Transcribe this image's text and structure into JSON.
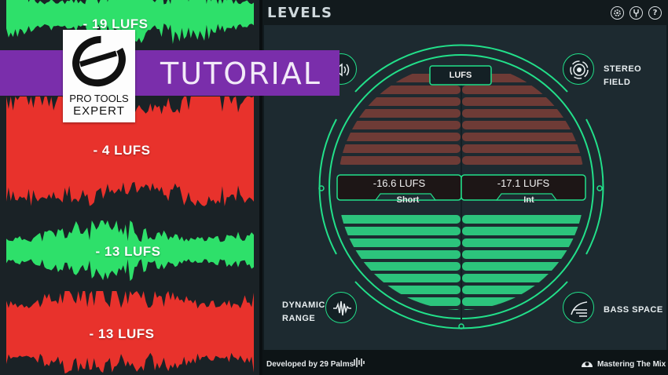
{
  "thumbnail": {
    "waveforms": [
      {
        "label": "- 19 LUFS",
        "color": "#2ee06a"
      },
      {
        "label": "- 4 LUFS",
        "color": "#e8322c"
      },
      {
        "label": "- 13 LUFS",
        "color": "#2ee06a"
      },
      {
        "label": "- 13 LUFS",
        "color": "#e8322c"
      }
    ],
    "banner": {
      "text": "TUTORIAL",
      "color": "#7a2eab"
    },
    "logo": {
      "line1": "PRO TOOLS",
      "line2": "EXPERT"
    }
  },
  "plugin": {
    "title": "LEVELS",
    "header_buttons": [
      {
        "icon": "gear-icon"
      },
      {
        "icon": "tuning-fork-icon"
      },
      {
        "icon": "help-icon",
        "glyph": "?"
      }
    ],
    "modes": {
      "loudness": {
        "icon": "speaker-icon"
      },
      "stereo_field": {
        "label": "STEREO FIELD",
        "icon": "stereo-rings-icon"
      },
      "dynamic_range": {
        "label_line1": "DYNAMIC",
        "label_line2": "RANGE",
        "icon": "waveform-icon"
      },
      "bass_space": {
        "label": "BASS SPACE",
        "icon": "bass-lines-icon"
      }
    },
    "meter": {
      "mode_label": "LUFS",
      "short_term": {
        "value": "-16.6 LUFS",
        "label": "Short"
      },
      "integrated": {
        "value": "-17.1 LUFS",
        "label": "Int"
      },
      "accent_color": "#22e08a",
      "fill_color": "#2cc47c",
      "empty_color": "#6e3b36"
    },
    "footer": {
      "developer": "Developed by 29 Palms",
      "brand": "Mastering The Mix"
    }
  }
}
